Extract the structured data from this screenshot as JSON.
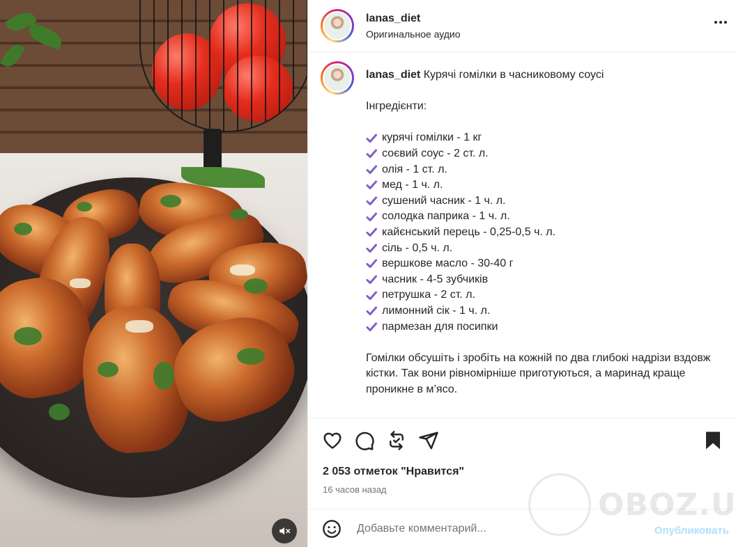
{
  "header": {
    "username": "lanas_diet",
    "audio": "Оригинальное аудио"
  },
  "caption": {
    "username": "lanas_diet",
    "title": "Курячі гомілки в часниковому соусі",
    "ingredients_heading": "Інгредієнти:",
    "ingredients": [
      "курячі гомілки - 1 кг",
      "соєвий соус - 2 ст. л.",
      "олія - 1 ст. л.",
      "мед - 1 ч. л.",
      "сушений часник - 1 ч. л.",
      "солодка паприка - 1 ч. л.",
      "кайєнський перець - 0,25-0,5 ч. л.",
      "сіль - 0,5 ч. л.",
      "вершкове масло - 30-40 г",
      "часник - 4-5 зубчиків",
      "петрушка - 2 ст. л.",
      "лимонний сік - 1 ч. л.",
      "пармезан для посипки"
    ],
    "paragraph": "Гомілки обсушіть і зробіть на кожній по два глибокі надрізи вздовж кістки. Так вони рівномірніше приготуються, а маринад краще проникне в м’ясо."
  },
  "likes": "2 053 отметок \"Нравится\"",
  "time_ago": "16 часов назад",
  "comment": {
    "placeholder": "Добавьте комментарий...",
    "publish_label": "Опубликовать"
  },
  "watermark": "OBOZ.UA",
  "icons": {
    "mute": "speaker-muted-icon",
    "more": "more-options-icon",
    "like": "heart-icon",
    "comment": "comment-bubble-icon",
    "repost": "repost-icon",
    "share": "paper-plane-icon",
    "save": "bookmark-icon",
    "emoji": "emoji-icon",
    "check": "check-mark-icon"
  },
  "colors": {
    "check": "#7f5cc8",
    "publish": "#b2dffc",
    "muted_text": "#737373"
  }
}
